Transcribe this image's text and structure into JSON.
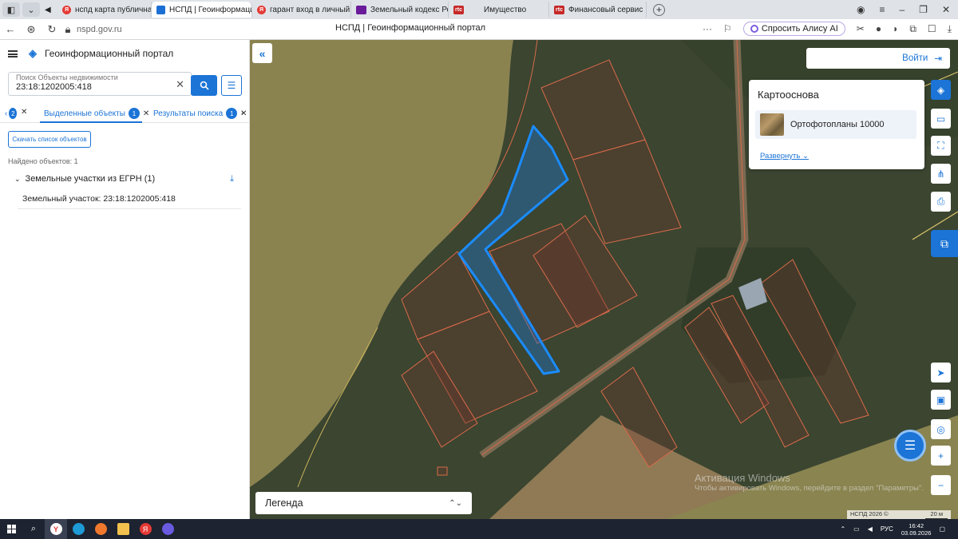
{
  "browser": {
    "tabs": [
      {
        "label": "нспд карта публичная ка",
        "icon": "yandex-icon"
      },
      {
        "label": "НСПД | Геоинформаци",
        "icon": "nspd-icon",
        "active": true
      },
      {
        "label": "гарант вход в личный ка",
        "icon": "yandex-icon"
      },
      {
        "label": "Земельный кодекс Росси",
        "icon": "garant-icon"
      },
      {
        "label": "Имущество",
        "icon": "rtc-icon"
      },
      {
        "label": "Финансовый сервис",
        "icon": "rtc-icon"
      }
    ],
    "url": "nspd.gov.ru",
    "page_title": "НСПД | Геоинформационный портал",
    "alice_label": "Спросить Алису AI"
  },
  "panel": {
    "app_title": "Геоинформационный портал",
    "search_placeholder": "Поиск Объекты недвижимости",
    "search_value": "23:18:1202005:418",
    "tabs": [
      {
        "label": "Выделенные объекты",
        "count": "1"
      },
      {
        "label": "Результаты поиска",
        "count": "1"
      }
    ],
    "download_list": "Скачать список объектов",
    "found": "Найдено объектов: 1",
    "group_label": "Земельные участки из ЕГРН (1)",
    "row_label": "Земельный участок:",
    "row_value": "23:18:1202005:418"
  },
  "map": {
    "login": "Войти",
    "basemap_title": "Картооснова",
    "basemap_item": "Ортофотопланы 10000",
    "basemap_expand": "Развернуть",
    "legend": "Легенда",
    "watermark_title": "Активация Windows",
    "watermark_text": "Чтобы активировать Windows, перейдите в раздел \"Параметры\".",
    "attribution": "НСПД 2026 ©",
    "scale": "20 м",
    "colors": {
      "highlight": "#1b74d6",
      "parcel_border": "#d96b4a",
      "accent": "#1b74d6"
    }
  },
  "taskbar": {
    "lang": "РУС",
    "time": "16:42",
    "date": "03.09.2026"
  }
}
